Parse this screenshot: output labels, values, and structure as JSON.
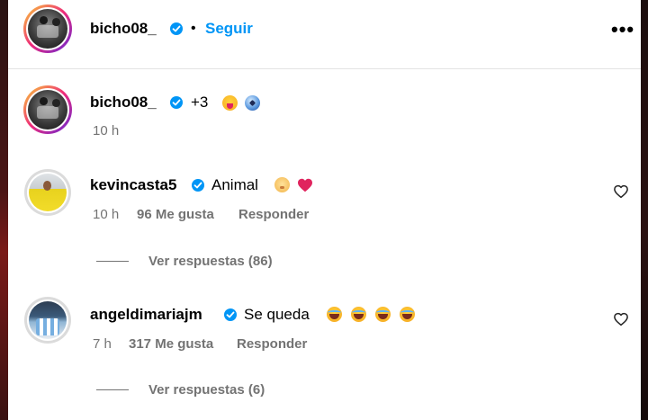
{
  "post_header": {
    "username": "bicho08_",
    "separator": "•",
    "follow_label": "Seguir",
    "more_label": "•••"
  },
  "caption": {
    "username": "bicho08_",
    "text": "+3",
    "emojis": [
      "face-with-tongue-emoji",
      "soccer-ball-emoji"
    ],
    "time": "10 h"
  },
  "comments": [
    {
      "username": "kevincasta5",
      "text": "Animal",
      "emojis": [
        "baby-emoji",
        "red-heart-emoji"
      ],
      "time": "10 h",
      "likes": "96 Me gusta",
      "reply_label": "Responder",
      "view_replies": "Ver respuestas (86)"
    },
    {
      "username": "angeldimariajm",
      "text": "Se queda",
      "emojis": [
        "laughing-tears-emoji",
        "laughing-tears-emoji",
        "laughing-tears-emoji",
        "laughing-tears-emoji"
      ],
      "time": "7 h",
      "likes": "317 Me gusta",
      "reply_label": "Responder",
      "view_replies": "Ver respuestas (6)"
    }
  ],
  "colors": {
    "accent": "#0095f6",
    "secondary_text": "#737373",
    "verified": "#0095f6"
  }
}
